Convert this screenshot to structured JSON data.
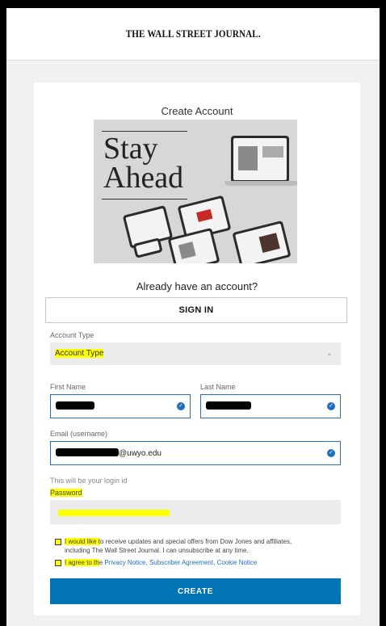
{
  "header": {
    "logo": "THE WALL STREET JOURNAL."
  },
  "form": {
    "title": "Create Account",
    "hero": {
      "line1": "Stay",
      "line2": "Ahead"
    },
    "already_text": "Already have an account?",
    "signin_label": "SIGN IN",
    "account_type": {
      "label": "Account Type",
      "value": "Account Type"
    },
    "first_name": {
      "label": "First Name"
    },
    "last_name": {
      "label": "Last Name"
    },
    "email": {
      "label": "Email (username)",
      "visible_suffix": "@uwyo.edu",
      "hint": "This will be your login id"
    },
    "password": {
      "label": "Password"
    },
    "marketing_opt": {
      "line1_highlight": "I would like t",
      "line1_rest": "o receive updates and special offers from Dow Jones and affiliates,",
      "line2": "including The Wall Street Journal. I can unsubscribe at any time."
    },
    "agree": {
      "prefix_highlight": "I agree to th",
      "prefix_rest": "e ",
      "privacy": "Privacy Notice",
      "sep1": ", ",
      "subscriber": "Subscriber Agreement",
      "sep2": ", ",
      "cookie": "Cookie Notice"
    },
    "create_label": "CREATE"
  },
  "colors": {
    "accent": "#0274b6",
    "highlight": "#ffff00",
    "field_border": "#2a6fb7"
  },
  "icons": {
    "select": "chevron-down-icon",
    "valid": "check-circle-icon"
  }
}
